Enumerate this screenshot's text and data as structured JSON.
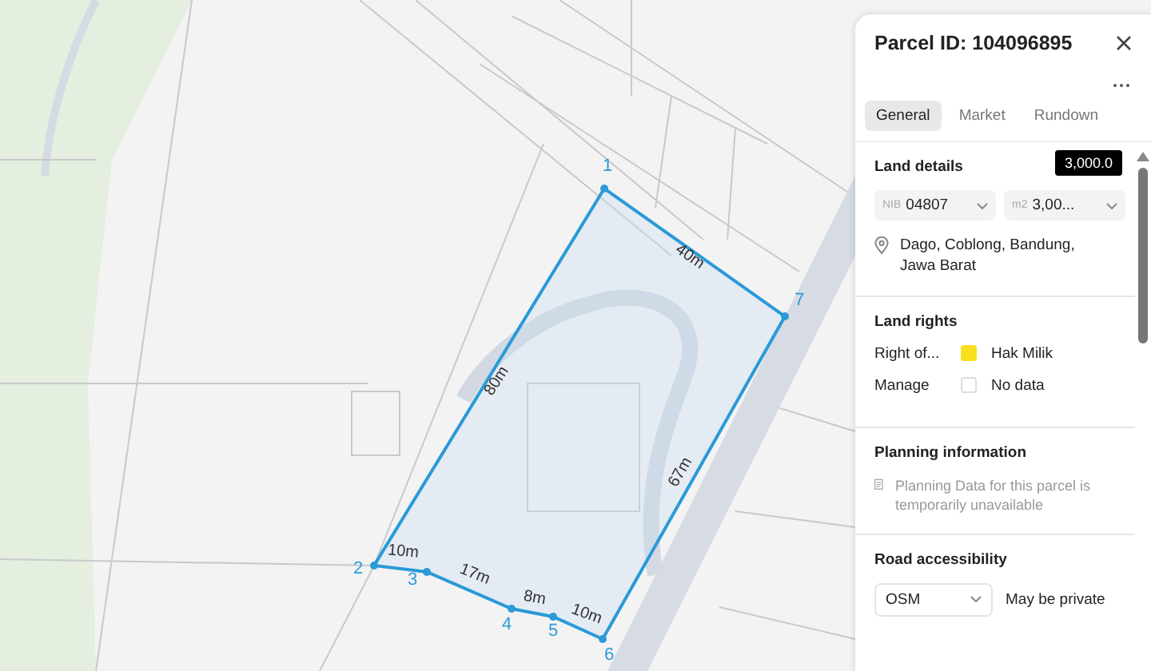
{
  "map": {
    "vertices": [
      {
        "label": "1"
      },
      {
        "label": "7"
      },
      {
        "label": "6"
      },
      {
        "label": "5"
      },
      {
        "label": "4"
      },
      {
        "label": "3"
      },
      {
        "label": "2"
      }
    ],
    "edges": [
      {
        "label": "40m"
      },
      {
        "label": "67m"
      },
      {
        "label": "10m"
      },
      {
        "label": "8m"
      },
      {
        "label": "17m"
      },
      {
        "label": "10m"
      },
      {
        "label": "80m"
      }
    ]
  },
  "panel": {
    "title": "Parcel ID: 104096895",
    "tabs": [
      {
        "label": "General",
        "selected": true
      },
      {
        "label": "Market",
        "selected": false
      },
      {
        "label": "Rundown",
        "selected": false
      }
    ],
    "land_details": {
      "heading": "Land details",
      "tooltip": "3,000.0",
      "selects": [
        {
          "prefix": "NIB",
          "value": "04807"
        },
        {
          "prefix": "m2",
          "value": "3,00..."
        }
      ],
      "location": "Dago, Coblong, Bandung, Jawa Barat"
    },
    "land_rights": {
      "heading": "Land rights",
      "rows": [
        {
          "label": "Right of...",
          "color": "#f7df1e",
          "value": "Hak Milik"
        },
        {
          "label": "Manage",
          "value": "No data"
        }
      ]
    },
    "planning": {
      "heading": "Planning information",
      "note": "Planning Data for this parcel is temporarily unavailable"
    },
    "road": {
      "heading": "Road accessibility",
      "select": "OSM",
      "note": "May be private"
    }
  }
}
